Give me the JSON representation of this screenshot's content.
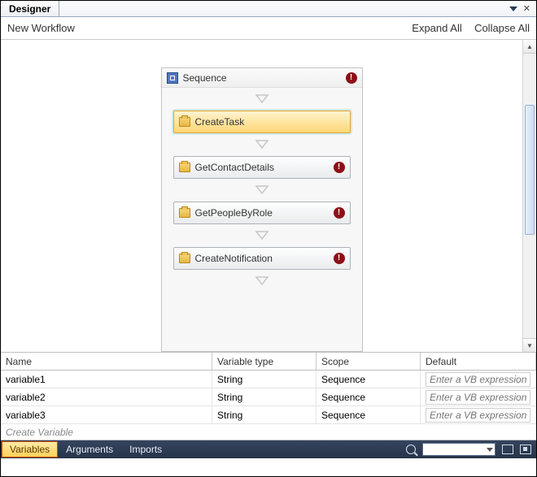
{
  "title_tab": "Designer",
  "toolbar": {
    "workflow_name": "New Workflow",
    "expand_all": "Expand All",
    "collapse_all": "Collapse All"
  },
  "sequence": {
    "title": "Sequence",
    "has_error": true,
    "activities": [
      {
        "label": "CreateTask",
        "selected": true,
        "has_error": false
      },
      {
        "label": "GetContactDetails",
        "selected": false,
        "has_error": true
      },
      {
        "label": "GetPeopleByRole",
        "selected": false,
        "has_error": true
      },
      {
        "label": "CreateNotification",
        "selected": false,
        "has_error": true
      }
    ]
  },
  "grid": {
    "headers": {
      "name": "Name",
      "type": "Variable type",
      "scope": "Scope",
      "default": "Default"
    },
    "rows": [
      {
        "name": "variable1",
        "type": "String",
        "scope": "Sequence",
        "default_placeholder": "Enter a VB expression"
      },
      {
        "name": "variable2",
        "type": "String",
        "scope": "Sequence",
        "default_placeholder": "Enter a VB expression"
      },
      {
        "name": "variable3",
        "type": "String",
        "scope": "Sequence",
        "default_placeholder": "Enter a VB expression"
      }
    ],
    "create_label": "Create Variable"
  },
  "statusbar": {
    "variables": "Variables",
    "arguments": "Arguments",
    "imports": "Imports"
  }
}
